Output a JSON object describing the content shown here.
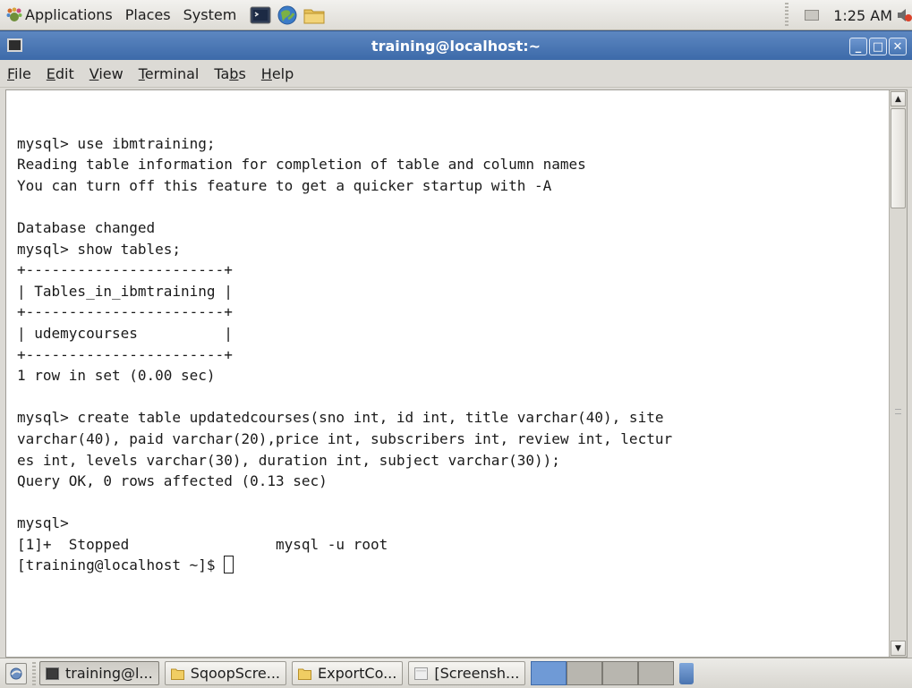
{
  "top_panel": {
    "menus": [
      "Applications",
      "Places",
      "System"
    ],
    "clock": "1:25 AM"
  },
  "window": {
    "title": "training@localhost:~",
    "buttons": {
      "minimize": "_",
      "maximize": "□",
      "close": "✕"
    }
  },
  "menubar": {
    "items": [
      {
        "accel": "F",
        "rest": "ile"
      },
      {
        "accel": "E",
        "rest": "dit"
      },
      {
        "accel": "V",
        "rest": "iew"
      },
      {
        "accel": "T",
        "rest": "erminal"
      },
      {
        "pre": "Ta",
        "accel": "b",
        "rest": "s"
      },
      {
        "accel": "H",
        "rest": "elp"
      }
    ]
  },
  "terminal": {
    "lines": [
      "",
      "mysql> use ibmtraining;",
      "Reading table information for completion of table and column names",
      "You can turn off this feature to get a quicker startup with -A",
      "",
      "Database changed",
      "mysql> show tables;",
      "+-----------------------+",
      "| Tables_in_ibmtraining |",
      "+-----------------------+",
      "| udemycourses          |",
      "+-----------------------+",
      "1 row in set (0.00 sec)",
      "",
      "mysql> create table updatedcourses(sno int, id int, title varchar(40), site",
      "varchar(40), paid varchar(20),price int, subscribers int, review int, lectur",
      "es int, levels varchar(30), duration int, subject varchar(30));",
      "Query OK, 0 rows affected (0.13 sec)",
      "",
      "mysql>",
      "[1]+  Stopped                 mysql -u root",
      "[training@localhost ~]$ "
    ]
  },
  "taskbar": {
    "tasks": [
      {
        "label": "training@l...",
        "icon": "terminal-icon",
        "active": true
      },
      {
        "label": "SqoopScre...",
        "icon": "folder-icon",
        "active": false
      },
      {
        "label": "ExportCo...",
        "icon": "folder-icon",
        "active": false
      },
      {
        "label": "[Screensh...",
        "icon": "image-icon",
        "active": false
      }
    ]
  }
}
